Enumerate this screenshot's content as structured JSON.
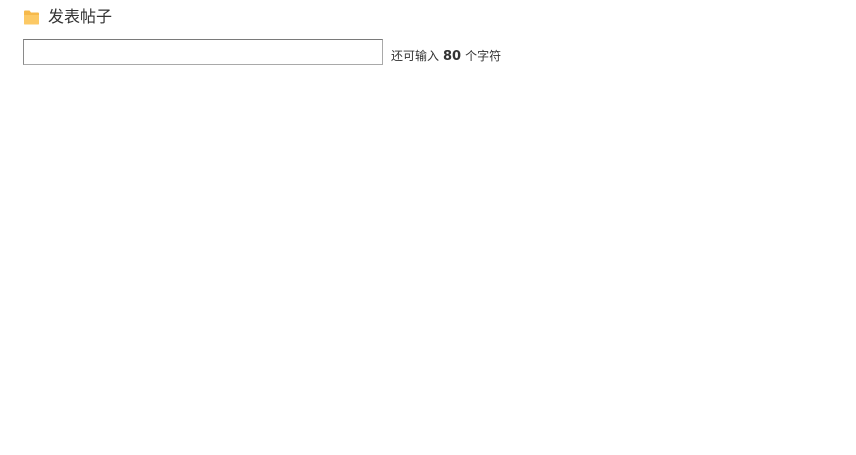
{
  "header": {
    "title": "发表帖子",
    "icon": "folder-icon",
    "icon_color": "#f6b94b"
  },
  "form": {
    "subject_value": "",
    "counter_prefix": "还可输入",
    "counter_remaining": "80",
    "counter_suffix": "个字符"
  }
}
